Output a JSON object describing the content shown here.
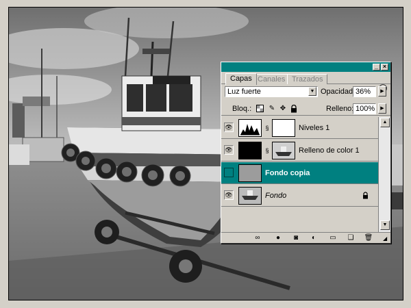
{
  "tabs": {
    "capas": "Capas",
    "canales": "Canales",
    "trazados": "Trazados"
  },
  "blend": {
    "mode": "Luz fuerte",
    "opacity_label": "Opacidad:",
    "opacity_value": "36%"
  },
  "lock": {
    "label": "Bloq.:",
    "fill_label": "Relleno:",
    "fill_value": "100%"
  },
  "layers": [
    {
      "name": "Niveles 1",
      "visible": true,
      "selected": false
    },
    {
      "name": "Relleno de color 1",
      "visible": true,
      "selected": false
    },
    {
      "name": "Fondo copia",
      "visible": false,
      "selected": true
    },
    {
      "name": "Fondo",
      "visible": true,
      "selected": false,
      "locked": true
    }
  ],
  "colors": {
    "titlebar": "#008080",
    "selection": "#008080",
    "panel": "#d4d0c8"
  },
  "icons": {
    "eye": "eye-icon",
    "chain": "link-icon",
    "lock": "lock-icon"
  }
}
